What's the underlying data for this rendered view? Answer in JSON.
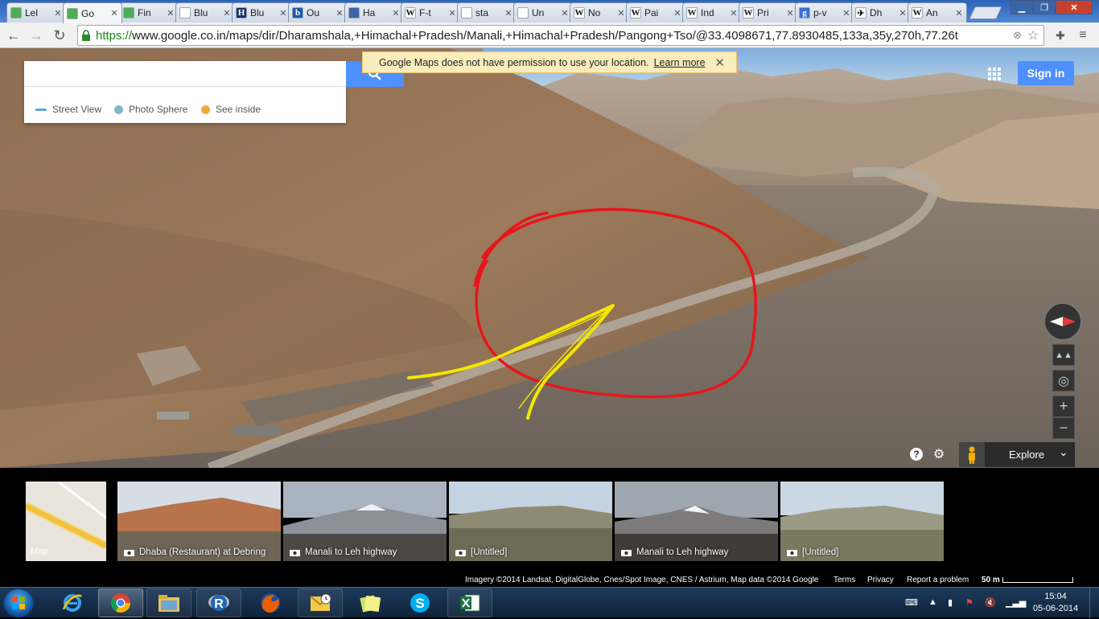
{
  "browser": {
    "tabs": [
      {
        "label": "Lel",
        "favicon": "google-maps-favicon"
      },
      {
        "label": "Go",
        "favicon": "google-maps-favicon",
        "active": true
      },
      {
        "label": "Fin",
        "favicon": "google-maps-favicon"
      },
      {
        "label": "Blu",
        "favicon": "document-favicon"
      },
      {
        "label": "Blu",
        "favicon": "h-favicon"
      },
      {
        "label": "Ou",
        "favicon": "b-favicon"
      },
      {
        "label": "Ha",
        "favicon": "person-favicon"
      },
      {
        "label": "F-t",
        "favicon": "wikipedia-favicon"
      },
      {
        "label": "sta",
        "favicon": "document-favicon"
      },
      {
        "label": "Un",
        "favicon": "document-favicon"
      },
      {
        "label": "No",
        "favicon": "wikipedia-favicon"
      },
      {
        "label": "Pai",
        "favicon": "wikipedia-favicon"
      },
      {
        "label": "Ind",
        "favicon": "wikipedia-favicon"
      },
      {
        "label": "Pri",
        "favicon": "wikipedia-favicon"
      },
      {
        "label": "p-v",
        "favicon": "google-favicon"
      },
      {
        "label": "Dh",
        "favicon": "plane-favicon"
      },
      {
        "label": "An",
        "favicon": "wikipedia-favicon"
      }
    ],
    "url_scheme": "https://",
    "url_rest": "www.google.co.in/maps/dir/Dharamshala,+Himachal+Pradesh/Manali,+Himachal+Pradesh/Pangong+Tso/@33.4098671,77.8930485,133a,35y,270h,77.26t"
  },
  "maps": {
    "search_placeholder": "",
    "legend": [
      {
        "label": "Street View",
        "color": "#5fa8d3",
        "shape": "line"
      },
      {
        "label": "Photo Sphere",
        "color": "#7fb8c8",
        "shape": "dot"
      },
      {
        "label": "See inside",
        "color": "#f2a93b",
        "shape": "dot"
      }
    ],
    "permission_message": "Google Maps does not have permission to use your location.",
    "permission_link": "Learn more",
    "sign_in": "Sign in",
    "explore": "Explore",
    "zoom_in": "+",
    "zoom_out": "−",
    "help": "?"
  },
  "filmstrip": {
    "map_label": "Map",
    "photos": [
      {
        "caption": "Dhaba (Restaurant) at Debring"
      },
      {
        "caption": "Manali to Leh highway"
      },
      {
        "caption": "[Untitled]"
      },
      {
        "caption": "Manali to Leh highway"
      },
      {
        "caption": "[Untitled]"
      }
    ]
  },
  "attribution": {
    "imagery": "Imagery ©2014 Landsat, DigitalGlobe, Cnes/Spot Image, CNES / Astrium, Map data ©2014 Google",
    "terms": "Terms",
    "privacy": "Privacy",
    "report": "Report a problem",
    "scale": "50 m"
  },
  "taskbar": {
    "apps": [
      "internet-explorer",
      "chrome",
      "file-explorer",
      "r-project",
      "firefox",
      "outlook",
      "sticky-notes",
      "skype",
      "excel"
    ],
    "time": "15:04",
    "date": "05-06-2014"
  },
  "annotations": {
    "red_circle_color": "#e8141b",
    "yellow_arrow_color": "#f3e600"
  }
}
